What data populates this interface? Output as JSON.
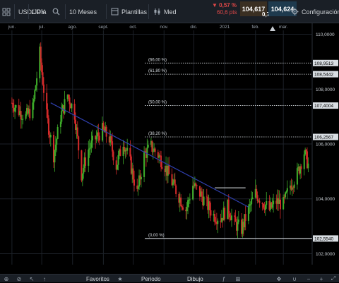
{
  "toolbar": {
    "symbol": "USD/JPY",
    "timeframe": "1 Día",
    "range": "10 Meses",
    "templates": "Plantillas",
    "price_type": "Med",
    "change_pct": "▼ 0,57 %",
    "change_pts": "60,6 pts",
    "bid": "104,617",
    "spread": "0,7",
    "ask": "104,624",
    "settings": "Configuración"
  },
  "bottombar": {
    "favorites": "Favoritos",
    "period": "Periodo",
    "drawing": "Dibujo"
  },
  "colors": {
    "up": "#3fae2a",
    "down": "#d42a2a",
    "trendline": "#2f3fae",
    "bid_bg": "#3a2f22",
    "ask_bg": "#1e3a4e"
  },
  "chart_data": {
    "type": "candlestick",
    "symbol": "USD/JPY",
    "x_tick_labels": [
      "jun.",
      "jul.",
      "ago.",
      "sept.",
      "oct.",
      "nov.",
      "dic.",
      "2021",
      "feb.",
      "mar."
    ],
    "y_tick_labels": [
      "110,0000",
      "108,0000",
      "106,0000",
      "104,0000",
      "102,0000"
    ],
    "ylim": [
      101.6,
      110.4
    ],
    "fibonacci": [
      {
        "label": "(66,00 %)",
        "value": 108.9513,
        "value_label": "108,9513"
      },
      {
        "label": "(61,80 %)",
        "value": 108.5442,
        "value_label": "108,5442"
      },
      {
        "label": "(50,00 %)",
        "value": 107.4004,
        "value_label": "107,4004"
      },
      {
        "label": "(38,20 %)",
        "value": 106.2567,
        "value_label": "106,2567"
      },
      {
        "label": "(0,00 %)",
        "value": 102.554,
        "value_label": "102,5540"
      }
    ],
    "trendline": {
      "from": {
        "x": "2020-07-10",
        "y": 107.5
      },
      "to": {
        "x": "2021-01-25",
        "y": 103.7
      }
    },
    "resistance": {
      "from": "2020-12-22",
      "to": "2021-01-22",
      "value": 104.4
    },
    "weekly_closes": [
      {
        "date": "2020-06-01",
        "close": 107.5
      },
      {
        "date": "2020-06-08",
        "close": 107.2
      },
      {
        "date": "2020-06-15",
        "close": 107.0
      },
      {
        "date": "2020-06-22",
        "close": 107.3
      },
      {
        "date": "2020-06-29",
        "close": 109.3
      },
      {
        "date": "2020-07-06",
        "close": 107.0
      },
      {
        "date": "2020-07-13",
        "close": 105.6
      },
      {
        "date": "2020-07-20",
        "close": 107.0
      },
      {
        "date": "2020-07-27",
        "close": 107.8
      },
      {
        "date": "2020-08-03",
        "close": 107.1
      },
      {
        "date": "2020-08-10",
        "close": 104.9
      },
      {
        "date": "2020-08-17",
        "close": 105.8
      },
      {
        "date": "2020-08-24",
        "close": 106.2
      },
      {
        "date": "2020-08-31",
        "close": 106.5
      },
      {
        "date": "2020-09-07",
        "close": 106.2
      },
      {
        "date": "2020-09-14",
        "close": 105.2
      },
      {
        "date": "2020-09-21",
        "close": 106.1
      },
      {
        "date": "2020-09-28",
        "close": 105.3
      },
      {
        "date": "2020-10-05",
        "close": 104.2
      },
      {
        "date": "2020-10-12",
        "close": 105.6
      },
      {
        "date": "2020-10-19",
        "close": 105.9
      },
      {
        "date": "2020-10-26",
        "close": 105.6
      },
      {
        "date": "2020-11-02",
        "close": 105.2
      },
      {
        "date": "2020-11-09",
        "close": 104.6
      },
      {
        "date": "2020-11-16",
        "close": 104.1
      },
      {
        "date": "2020-11-23",
        "close": 103.6
      },
      {
        "date": "2020-11-30",
        "close": 104.5
      },
      {
        "date": "2020-12-07",
        "close": 104.2
      },
      {
        "date": "2020-12-14",
        "close": 103.8
      },
      {
        "date": "2020-12-21",
        "close": 103.4
      },
      {
        "date": "2020-12-28",
        "close": 103.3
      },
      {
        "date": "2021-01-04",
        "close": 103.7
      },
      {
        "date": "2021-01-11",
        "close": 103.1
      },
      {
        "date": "2021-01-18",
        "close": 102.9
      },
      {
        "date": "2021-01-25",
        "close": 103.6
      },
      {
        "date": "2021-02-01",
        "close": 104.2
      },
      {
        "date": "2021-02-08",
        "close": 103.9
      },
      {
        "date": "2021-02-15",
        "close": 103.6
      },
      {
        "date": "2021-02-22",
        "close": 103.9
      },
      {
        "date": "2021-03-01",
        "close": 103.8
      },
      {
        "date": "2021-03-08",
        "close": 104.5
      },
      {
        "date": "2021-03-15",
        "close": 104.9
      },
      {
        "date": "2021-03-22",
        "close": 105.7
      },
      {
        "date": "2021-03-29",
        "close": 104.9
      }
    ]
  }
}
